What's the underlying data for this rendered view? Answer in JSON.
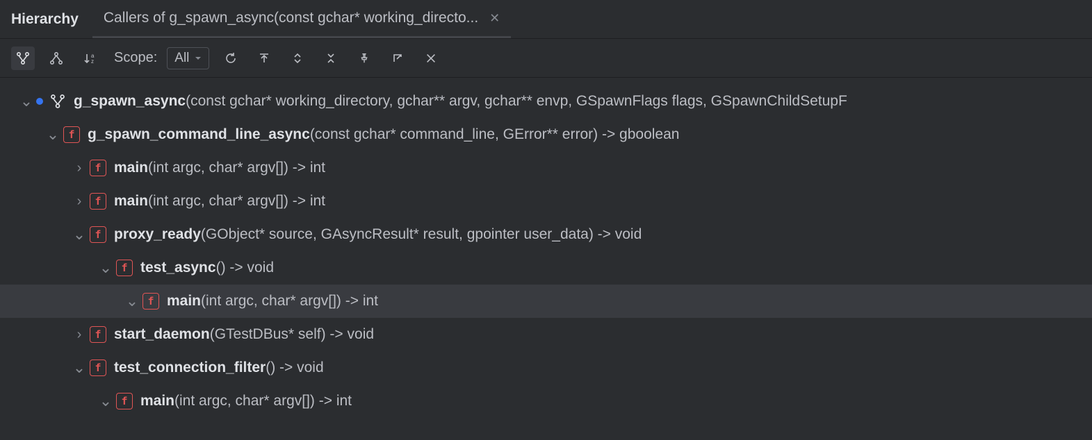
{
  "header": {
    "title": "Hierarchy",
    "tab_label": "Callers of g_spawn_async(const gchar* working_directo..."
  },
  "toolbar": {
    "scope_label": "Scope:",
    "scope_value": "All"
  },
  "tree": [
    {
      "depth": 0,
      "chev": "down",
      "dot": true,
      "icon": "branch",
      "name": "g_spawn_async",
      "sig": "(const gchar* working_directory, gchar** argv, gchar** envp, GSpawnFlags flags, GSpawnChildSetupF"
    },
    {
      "depth": 1,
      "chev": "down",
      "icon": "f",
      "name": "g_spawn_command_line_async",
      "sig": "(const gchar* command_line, GError** error) -> gboolean"
    },
    {
      "depth": 2,
      "chev": "right",
      "icon": "f",
      "name": "main",
      "sig": "(int argc, char* argv[]) -> int"
    },
    {
      "depth": 2,
      "chev": "right",
      "icon": "f",
      "name": "main",
      "sig": "(int argc, char* argv[]) -> int"
    },
    {
      "depth": 2,
      "chev": "down",
      "icon": "f",
      "name": "proxy_ready",
      "sig": "(GObject* source, GAsyncResult* result, gpointer user_data) -> void"
    },
    {
      "depth": 3,
      "chev": "down",
      "icon": "f",
      "name": "test_async",
      "sig": "() -> void"
    },
    {
      "depth": 4,
      "chev": "down",
      "icon": "f",
      "name": "main",
      "sig": "(int argc, char* argv[]) -> int",
      "selected": true
    },
    {
      "depth": 2,
      "chev": "right",
      "icon": "f",
      "name": "start_daemon",
      "sig": "(GTestDBus* self) -> void"
    },
    {
      "depth": 2,
      "chev": "down",
      "icon": "f",
      "name": "test_connection_filter",
      "sig": "() -> void"
    },
    {
      "depth": 3,
      "chev": "down",
      "icon": "f",
      "name": "main",
      "sig": "(int argc, char* argv[]) -> int"
    }
  ]
}
